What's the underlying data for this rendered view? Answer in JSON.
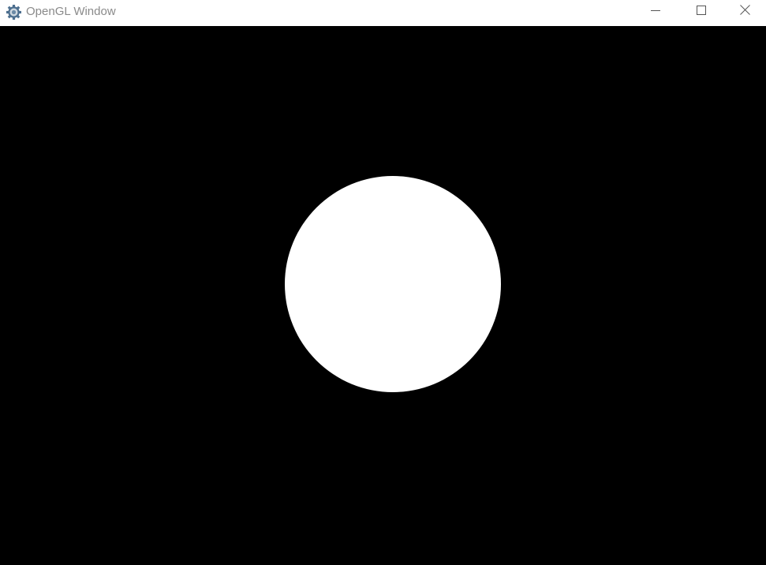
{
  "window": {
    "title": "OpenGL Window",
    "app_icon": "gear-icon",
    "controls": {
      "minimize_icon": "minimize-icon",
      "maximize_icon": "maximize-icon",
      "close_icon": "close-icon"
    }
  },
  "render": {
    "background_color": "#000000",
    "shape": "circle",
    "shape_color": "#ffffff"
  }
}
